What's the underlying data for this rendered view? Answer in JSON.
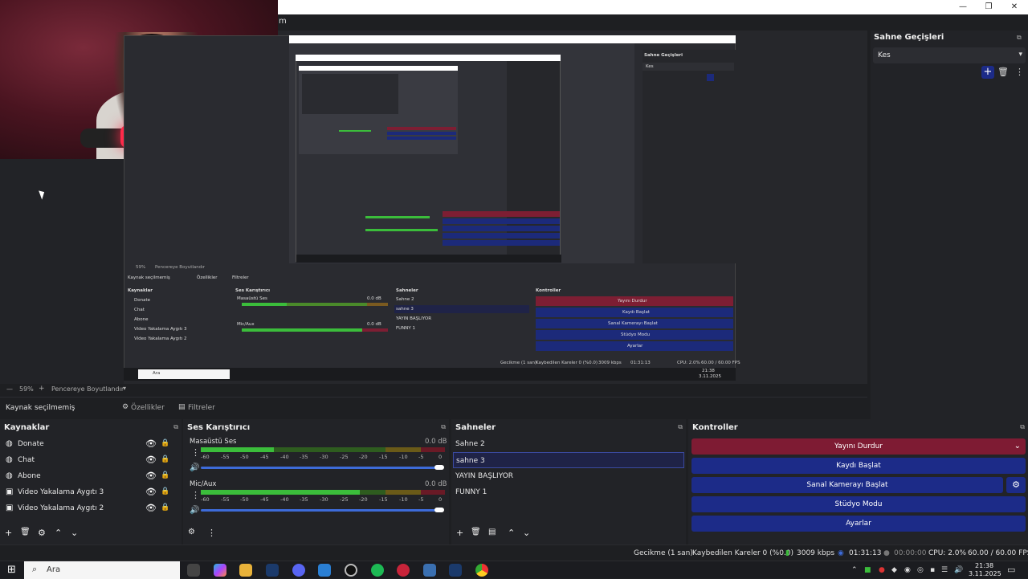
{
  "window": {
    "menu_letter": "m",
    "minimize": "—",
    "restore": "❐",
    "close": "✕"
  },
  "nested": {
    "sahne_gecisleri": "Sahne Geçişleri",
    "kes": "Kes",
    "kaynak_secilmemis": "Kaynak seçilmemiş",
    "ozellikler": "Özellikler",
    "filtreler": "Filtreler",
    "zoom": "59%",
    "pencere": "Pencereye Boyutlandır",
    "kaynaklar": "Kaynaklar",
    "ses": "Ses Karıştırıcı",
    "sahneler": "Sahneler",
    "kontroller": "Kontroller",
    "sources": [
      "Donate",
      "Chat",
      "Abone",
      "Video Yakalama Aygıtı 3",
      "Video Yakalama Aygıtı 2"
    ],
    "scenes": [
      "Sahne 2",
      "sahne 3",
      "YAYIN BAŞLIYOR",
      "FUNNY 1"
    ],
    "controls": [
      "Yayını Durdur",
      "Kaydı Başlat",
      "Sanal Kamerayı Başlat",
      "Stüdyo Modu",
      "Ayarlar"
    ],
    "mixer": [
      "Masaüstü Ses",
      "Mic/Aux"
    ],
    "db": "0.0 dB",
    "status": [
      "Gecikme (1 san)",
      "Kaybedilen Kareler 0 (%0.0)",
      "3009 kbps",
      "01:31:13",
      "CPU: 2.0%",
      "60.00 / 60.00 FPS"
    ],
    "search": "Ara",
    "time": "21:38",
    "date": "3.11.2025"
  },
  "transitions": {
    "title": "Sahne Geçişleri",
    "selected": "Kes"
  },
  "zoombar": {
    "zoom": "59%",
    "plus": "+",
    "resize_label": "Pencereye Boyutlandır"
  },
  "propbar": {
    "no_source": "Kaynak seçilmemiş",
    "properties": "Özellikler",
    "filters": "Filtreler"
  },
  "sources": {
    "title": "Kaynaklar",
    "items": [
      {
        "icon": "globe-icon",
        "label": "Donate"
      },
      {
        "icon": "globe-icon",
        "label": "Chat"
      },
      {
        "icon": "globe-icon",
        "label": "Abone"
      },
      {
        "icon": "camera-icon",
        "label": "Video Yakalama Aygıtı 3"
      },
      {
        "icon": "camera-icon",
        "label": "Video Yakalama Aygıtı 2"
      }
    ]
  },
  "mixer": {
    "title": "Ses Karıştırıcı",
    "channels": [
      {
        "name": "Masaüstü Ses",
        "db": "0.0 dB",
        "level": 0.3
      },
      {
        "name": "Mic/Aux",
        "db": "0.0 dB",
        "level": 0.65
      }
    ],
    "ticks": [
      "-60",
      "-55",
      "-50",
      "-45",
      "-40",
      "-35",
      "-30",
      "-25",
      "-20",
      "-15",
      "-10",
      "-5",
      "0"
    ]
  },
  "scenes": {
    "title": "Sahneler",
    "items": [
      "Sahne 2",
      "sahne 3",
      "YAYIN BAŞLIYOR",
      "FUNNY 1"
    ],
    "selected_index": 1
  },
  "controls": {
    "title": "Kontroller",
    "stop_stream": "Yayını Durdur",
    "start_record": "Kaydı Başlat",
    "start_virtualcam": "Sanal Kamerayı Başlat",
    "studio_mode": "Stüdyo Modu",
    "settings": "Ayarlar"
  },
  "status": {
    "delay": "Gecikme (1 san)",
    "dropped": "Kaybedilen Kareler 0 (%0.0)",
    "bitrate": "3009 kbps",
    "stream_time": "01:31:13",
    "record_time": "00:00:00",
    "cpu": "CPU: 2.0%",
    "fps": "60.00 / 60.00 FPS"
  },
  "taskbar": {
    "search_placeholder": "Ara",
    "time": "21:38",
    "date": "3.11.2025"
  },
  "colors": {
    "accent_blue": "#1c2b88",
    "stop_red": "#7e1b33",
    "meter_green": "#3bbd3b",
    "meter_yellow": "#b8a21e",
    "meter_red": "#c2263b"
  }
}
